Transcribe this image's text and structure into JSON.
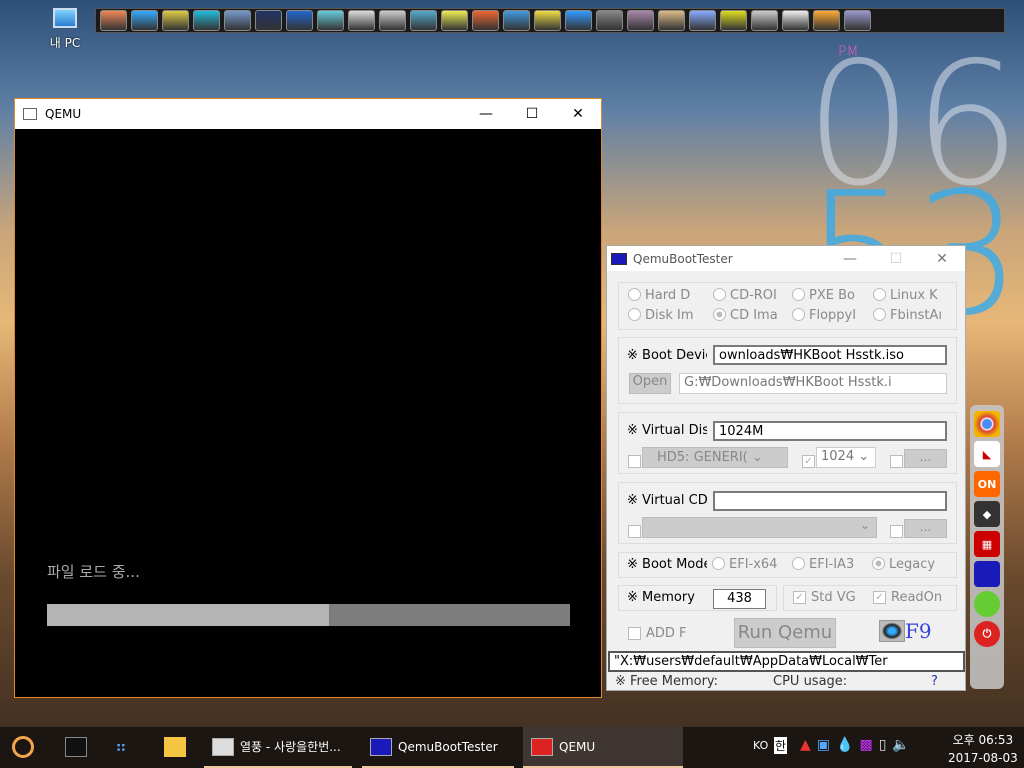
{
  "desktop": {
    "icon_label": "내 PC",
    "clock_ampm": "PM",
    "clock_hour": "06",
    "clock_min": "53"
  },
  "qemu": {
    "title": "QEMU",
    "loading_text": "파일 로드 중...",
    "progress": 0.54
  },
  "qbt": {
    "title": "QemuBootTester",
    "boot_types": [
      {
        "label": "Hard D",
        "on": false
      },
      {
        "label": "CD-ROI",
        "on": false
      },
      {
        "label": "PXE Bo",
        "on": false
      },
      {
        "label": "Linux K",
        "on": false
      },
      {
        "label": "Disk Im",
        "on": false
      },
      {
        "label": "CD Ima",
        "on": true
      },
      {
        "label": "FloppyI",
        "on": false
      },
      {
        "label": "FbinstAı",
        "on": false
      }
    ],
    "boot_device_label": "※ Boot Device :",
    "boot_device_value": "ownloads₩HKBoot Hsstk.iso",
    "open_label": "Open",
    "boot_device_path": "G:₩Downloads₩HKBoot Hsstk.i",
    "vdisk_label": "※ Virtual Disk :",
    "vdisk_value": "1024M",
    "hd_select": "HD5: GENERI(",
    "size_select": "1024",
    "browse": "...",
    "vcdr_label": "※ Virtual CDR :",
    "vcdr_value": "",
    "bootmode_label": "※ Boot Mode :",
    "bootmodes": [
      {
        "label": "EFI-x64",
        "on": false
      },
      {
        "label": "EFI-IA3",
        "on": false
      },
      {
        "label": "Legacy",
        "on": true
      }
    ],
    "memory_label": "※ Memory",
    "memory_value": "438",
    "stdvga": "Std VG",
    "readonly": "ReadOn",
    "add_label": "ADD F",
    "run_label": "Run Qemu",
    "f9": "F9",
    "cmdline": "\"X:₩users₩default₩AppData₩Local₩Ter",
    "free_mem": "※ Free Memory:",
    "cpu": "CPU usage:",
    "help": "?"
  },
  "taskbar": {
    "items": [
      {
        "label": "열풍 - 사랑을한번..."
      },
      {
        "label": "QemuBootTester"
      },
      {
        "label": "QEMU"
      }
    ],
    "lang": "KO",
    "ime": "한",
    "time_ampm": "오후 06:53",
    "date": "2017-08-03"
  },
  "colors": {
    "accent": "#e08a30",
    "taskbar": "#1c1613"
  }
}
